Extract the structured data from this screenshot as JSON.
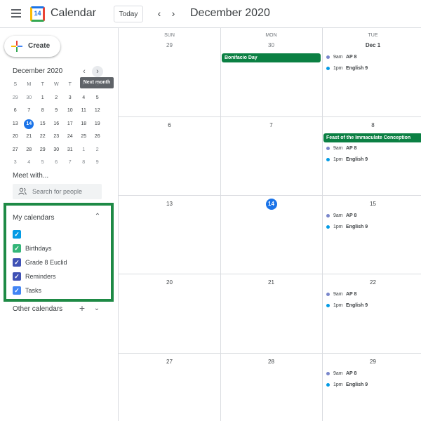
{
  "header": {
    "app_title": "Calendar",
    "logo_number": "14",
    "today_label": "Today",
    "prev_icon": "chevron-left",
    "next_icon": "chevron-right",
    "month_title": "December 2020"
  },
  "sidebar": {
    "create_label": "Create",
    "mini_calendar": {
      "title": "December 2020",
      "tooltip": "Next month",
      "weekdays": [
        "S",
        "M",
        "T",
        "W",
        "T",
        "F",
        "S"
      ],
      "weeks": [
        [
          "29",
          "30",
          "1",
          "2",
          "3",
          "4",
          "5"
        ],
        [
          "6",
          "7",
          "8",
          "9",
          "10",
          "11",
          "12"
        ],
        [
          "13",
          "14",
          "15",
          "16",
          "17",
          "18",
          "19"
        ],
        [
          "20",
          "21",
          "22",
          "23",
          "24",
          "25",
          "26"
        ],
        [
          "27",
          "28",
          "29",
          "30",
          "31",
          "1",
          "2"
        ],
        [
          "3",
          "4",
          "5",
          "6",
          "7",
          "8",
          "9"
        ]
      ],
      "selected_day": "14"
    },
    "meet_with_label": "Meet with...",
    "search_people_placeholder": "Search for people",
    "my_calendars_title": "My calendars",
    "my_calendars": [
      {
        "label": "",
        "color": "#039be5",
        "checked": true
      },
      {
        "label": "Birthdays",
        "color": "#33b679",
        "checked": true
      },
      {
        "label": "Grade 8 Euclid",
        "color": "#3f51b5",
        "checked": true
      },
      {
        "label": "Reminders",
        "color": "#3f51b5",
        "checked": true
      },
      {
        "label": "Tasks",
        "color": "#4285f4",
        "checked": true
      }
    ],
    "other_calendars_title": "Other calendars",
    "highlight_color": "#1e8a45"
  },
  "grid": {
    "columns": [
      {
        "dow": "SUN"
      },
      {
        "dow": "MON"
      },
      {
        "dow": "TUE"
      }
    ],
    "weeks": [
      {
        "days": [
          {
            "num": "29",
            "muted": true
          },
          {
            "num": "30",
            "muted": true,
            "chips": [
              "Bonifacio Day"
            ]
          },
          {
            "num": "Dec 1",
            "bold": true,
            "events": [
              {
                "time": "9am",
                "name": "AP 8",
                "color": "#7986cb"
              },
              {
                "time": "1pm",
                "name": "English 9",
                "color": "#039be5"
              }
            ]
          }
        ]
      },
      {
        "days": [
          {
            "num": "6"
          },
          {
            "num": "7"
          },
          {
            "num": "8",
            "chips": [
              "Feast of the Immaculate Conception"
            ],
            "events": [
              {
                "time": "9am",
                "name": "AP 8",
                "color": "#7986cb"
              },
              {
                "time": "1pm",
                "name": "English 9",
                "color": "#039be5"
              }
            ]
          }
        ]
      },
      {
        "days": [
          {
            "num": "13"
          },
          {
            "num": "14",
            "today": true
          },
          {
            "num": "15",
            "events": [
              {
                "time": "9am",
                "name": "AP 8",
                "color": "#7986cb"
              },
              {
                "time": "1pm",
                "name": "English 9",
                "color": "#039be5"
              }
            ]
          }
        ]
      },
      {
        "days": [
          {
            "num": "20"
          },
          {
            "num": "21"
          },
          {
            "num": "22",
            "events": [
              {
                "time": "9am",
                "name": "AP 8",
                "color": "#7986cb"
              },
              {
                "time": "1pm",
                "name": "English 9",
                "color": "#039be5"
              }
            ]
          }
        ]
      },
      {
        "days": [
          {
            "num": "27"
          },
          {
            "num": "28"
          },
          {
            "num": "29",
            "events": [
              {
                "time": "9am",
                "name": "AP 8",
                "color": "#7986cb"
              },
              {
                "time": "1pm",
                "name": "English 9",
                "color": "#039be5"
              }
            ]
          }
        ]
      }
    ],
    "chip_color": "#0b8043",
    "today_color": "#1a73e8"
  }
}
